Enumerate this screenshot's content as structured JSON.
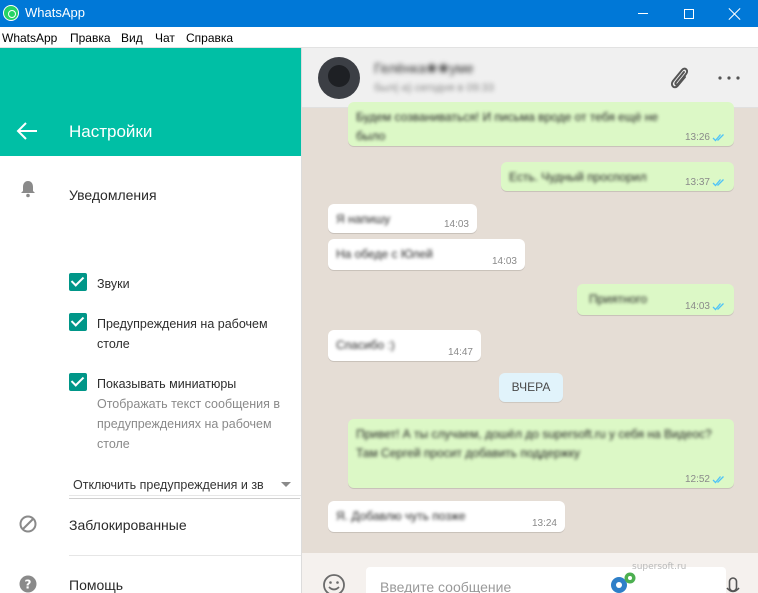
{
  "window": {
    "title": "WhatsApp"
  },
  "menu": [
    "WhatsApp",
    "Правка",
    "Вид",
    "Чат",
    "Справка"
  ],
  "settings": {
    "title": "Настройки",
    "notifications": {
      "title": "Уведомления",
      "sounds": {
        "label": "Звуки",
        "checked": true
      },
      "desktop_alerts": {
        "label": "Предупреждения на рабочем столе",
        "checked": true
      },
      "previews": {
        "label": "Показывать миниатюры",
        "sub": "Отображать текст сообщения в предупреждениях на рабочем столе",
        "checked": true
      },
      "mute_dropdown": "Отключить предупреждения и зв"
    },
    "blocked": "Заблокированные",
    "help": "Помощь"
  },
  "chat": {
    "contact_name": "Гелёнка❀❀уме",
    "contact_status": "был(-а) сегодня в 09:33",
    "messages": [
      {
        "dir": "out",
        "text": "Будем созваниваться! И письма вроде от тебя ещё не было",
        "time": "13:26",
        "read": true
      },
      {
        "dir": "out",
        "text": "Есть. Чудный проспорил",
        "time": "13:37",
        "read": true
      },
      {
        "dir": "in",
        "text": "Я напишу",
        "time": "14:03"
      },
      {
        "dir": "in",
        "text": "На обеде с Юлей",
        "time": "14:03"
      },
      {
        "dir": "out",
        "text": "Приятного",
        "time": "14:03",
        "read": true
      },
      {
        "dir": "in",
        "text": "Спасибо :)",
        "time": "14:47"
      },
      {
        "dir": "out",
        "text": "Привет! А ты случаем, дошёл до supersoft.ru у себя на Видеос? Там Сергей просит добавить поддержку",
        "time": "12:52",
        "read": true
      },
      {
        "dir": "in",
        "text": "Я. Добавлю чуть позже",
        "time": "13:24"
      }
    ],
    "date_divider": "ВЧЕРА",
    "composer_placeholder": "Введите сообщение",
    "watermark": "supersoft.ru"
  },
  "colors": {
    "header_teal": "#00bfa5",
    "checkbox": "#009688",
    "outgoing": "#dcf8c6",
    "titlebar": "#0078d7"
  }
}
